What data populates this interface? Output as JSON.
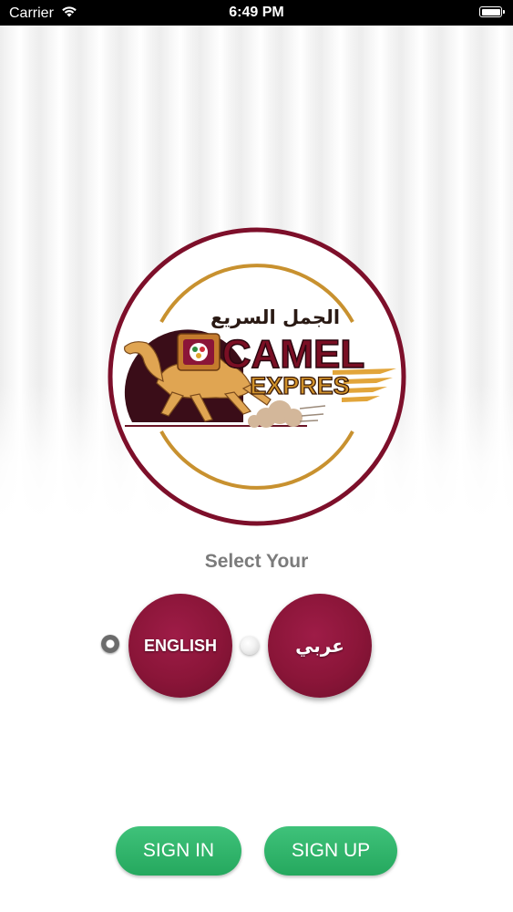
{
  "status_bar": {
    "carrier": "Carrier",
    "time": "6:49 PM"
  },
  "logo": {
    "arabic_name": "الجمل السريع",
    "word1": "CAMEL",
    "word2": "EXPRES",
    "colors": {
      "ring": "#7d0f2a",
      "arc": "#c8912f",
      "letters": "#7a0f24"
    }
  },
  "language": {
    "title": "Select Your",
    "options": [
      {
        "label": "ENGLISH",
        "selected": true
      },
      {
        "label": "عربي",
        "selected": false
      }
    ]
  },
  "actions": {
    "sign_in": "SIGN IN",
    "sign_up": "SIGN UP"
  },
  "colors": {
    "accent_maroon": "#8a1538",
    "green_button": "#2fb46a"
  }
}
